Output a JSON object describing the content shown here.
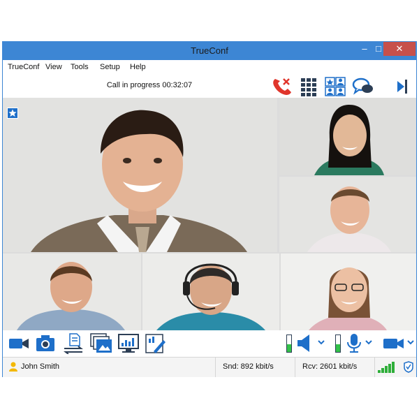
{
  "window": {
    "title": "TrueConf",
    "minimize_glyph": "–",
    "maximize_glyph": "□",
    "close_glyph": "✕"
  },
  "menu": {
    "items": [
      "TrueConf",
      "View",
      "Tools",
      "Setup",
      "Help"
    ]
  },
  "toolbar_top": {
    "call_status": "Call in progress 00:32:07",
    "icons": [
      "hangup-phone-icon",
      "dialpad-icon",
      "layout-contacts-icon",
      "chat-icon",
      "collapse-panel-icon"
    ]
  },
  "video": {
    "speaker_badge": "star-icon",
    "participants": [
      {
        "role": "main-speaker"
      },
      {
        "role": "participant"
      },
      {
        "role": "participant"
      },
      {
        "role": "participant"
      },
      {
        "role": "participant"
      },
      {
        "role": "participant"
      }
    ]
  },
  "toolbar_bottom": {
    "icons": [
      "camera-video-icon",
      "snapshot-camera-icon",
      "file-transfer-icon",
      "slideshow-icon",
      "screen-share-icon",
      "whiteboard-icon",
      "speaker-icon",
      "microphone-icon",
      "camera-toggle-icon"
    ],
    "speaker_level": 0.45,
    "mic_level": 0.45
  },
  "status": {
    "user_name": "John Smith",
    "send_rate": "Snd: 892 kbit/s",
    "receive_rate": "Rcv: 2601 kbit/s",
    "signal_bars": 5
  },
  "colors": {
    "accent": "#3d86d4",
    "hangup_red": "#e0352b",
    "icon_blue": "#1e6fc9",
    "level_green": "#33c24a",
    "signal_green": "#2fae3a"
  }
}
